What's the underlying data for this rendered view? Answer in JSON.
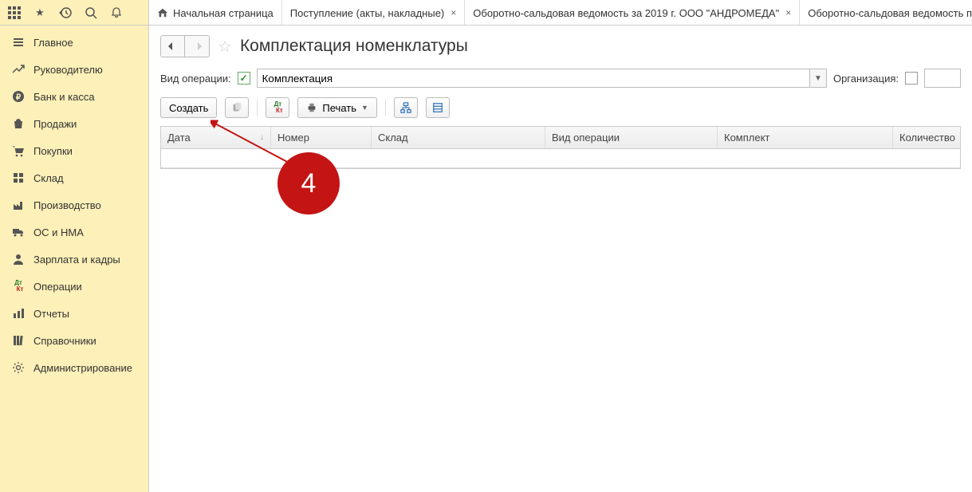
{
  "tabs": [
    {
      "label": "Начальная страница",
      "home": true,
      "closable": false
    },
    {
      "label": "Поступление (акты, накладные)",
      "closable": true
    },
    {
      "label": "Оборотно-сальдовая ведомость за 2019 г. ООО \"АНДРОМЕДА\"",
      "closable": true
    },
    {
      "label": "Оборотно-сальдовая ведомость по",
      "closable": false
    }
  ],
  "sidebar": {
    "items": [
      {
        "label": "Главное",
        "icon": "menu"
      },
      {
        "label": "Руководителю",
        "icon": "trend"
      },
      {
        "label": "Банк и касса",
        "icon": "ruble"
      },
      {
        "label": "Продажи",
        "icon": "bag"
      },
      {
        "label": "Покупки",
        "icon": "cart"
      },
      {
        "label": "Склад",
        "icon": "boxes"
      },
      {
        "label": "Производство",
        "icon": "factory"
      },
      {
        "label": "ОС и НМА",
        "icon": "truck"
      },
      {
        "label": "Зарплата и кадры",
        "icon": "person"
      },
      {
        "label": "Операции",
        "icon": "dtkt"
      },
      {
        "label": "Отчеты",
        "icon": "bars"
      },
      {
        "label": "Справочники",
        "icon": "books"
      },
      {
        "label": "Администрирование",
        "icon": "gear"
      }
    ]
  },
  "page": {
    "title": "Комплектация номенклатуры",
    "op_type_label": "Вид операции:",
    "op_type_value": "Комплектация",
    "org_label": "Организация:"
  },
  "toolbar": {
    "create": "Создать",
    "print": "Печать"
  },
  "table": {
    "columns": {
      "date": "Дата",
      "number": "Номер",
      "sklad": "Склад",
      "op": "Вид операции",
      "komplekt": "Комплект",
      "qty": "Количество"
    }
  },
  "annotation": {
    "number": "4"
  }
}
